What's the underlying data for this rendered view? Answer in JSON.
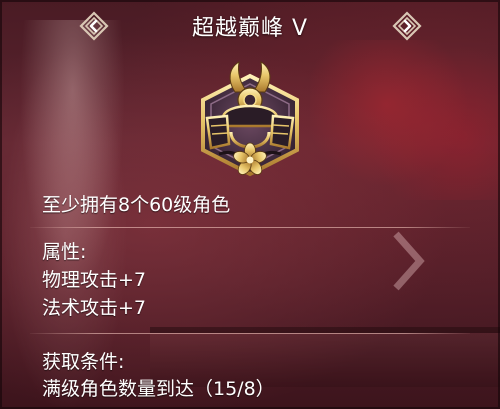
{
  "achievement": {
    "title": "超越巅峰 V",
    "requirement": "至少拥有8个60级角色"
  },
  "attributes": {
    "heading": "属性:",
    "items": [
      "物理攻击+7",
      "法术攻击+7"
    ]
  },
  "obtain": {
    "heading": "获取条件:",
    "condition": "满级角色数量到达（15/8）"
  },
  "icons": {
    "prev": "diamond-left-arrow-icon",
    "next": "diamond-right-arrow-icon",
    "medal": "samurai-helmet-medal-icon",
    "side": "chevron-right-icon"
  },
  "colors": {
    "background": "#4a1b24",
    "gold": "#e8c66a",
    "text": "#ffffff"
  }
}
